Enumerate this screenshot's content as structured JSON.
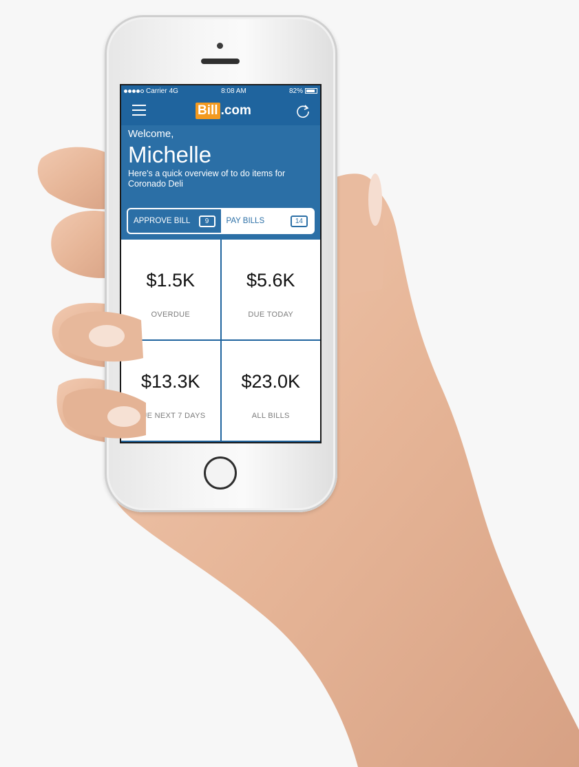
{
  "status_bar": {
    "carrier": "Carrier",
    "network": "4G",
    "time": "8:08 AM",
    "battery": "82%"
  },
  "navbar": {
    "logo_bill": "Bill",
    "logo_com": ".com",
    "icons": [
      "hamburger-menu-icon",
      "refresh-icon"
    ]
  },
  "welcome": {
    "greeting": "Welcome,",
    "name": "Michelle",
    "description": "Here's a quick overview of to do items for Coronado Deli"
  },
  "tabs": [
    {
      "label": "APPROVE BILL",
      "count": "9",
      "active": true
    },
    {
      "label": "PAY BILLS",
      "count": "14",
      "active": false
    }
  ],
  "tiles": [
    {
      "amount": "$1.5K",
      "label": "OVERDUE"
    },
    {
      "amount": "$5.6K",
      "label": "DUE TODAY"
    },
    {
      "amount": "$13.3K",
      "label": "DUE NEXT 7 DAYS"
    },
    {
      "amount": "$23.0K",
      "label": "ALL BILLS"
    }
  ],
  "colors": {
    "brand_blue": "#2b6fa6",
    "header_blue": "#1f649e",
    "logo_orange": "#f39a20"
  }
}
